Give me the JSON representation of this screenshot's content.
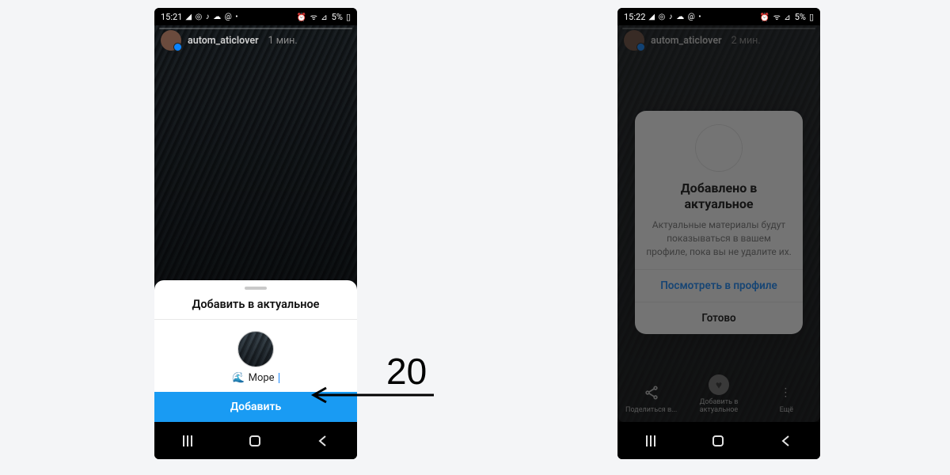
{
  "step_number": "20",
  "status_bar": {
    "time_left": "15:21",
    "time_right": "15:22",
    "indicator_icons": "◢ ◎ ♪ ☁ @ •",
    "right_icons": "⏰ �witness ᯤ ⊿ .ıl",
    "battery_text": "5%"
  },
  "story": {
    "username": "autom_aticlover",
    "age_left": "1 мин.",
    "age_right": "2 мин."
  },
  "sheet": {
    "title": "Добавить в актуальное",
    "highlight_emoji": "🌊",
    "highlight_name": "Море",
    "add_button": "Добавить"
  },
  "card": {
    "title_line1": "Добавлено в",
    "title_line2": "актуальное",
    "description": "Актуальные материалы будут показываться в вашем профиле, пока вы не удалите их.",
    "view_profile": "Посмотреть в профиле",
    "done": "Готово"
  },
  "story_actions": {
    "share_label": "Поделиться в...",
    "highlight_label": "Добавить в актуальное",
    "more_label": "Ещё"
  }
}
